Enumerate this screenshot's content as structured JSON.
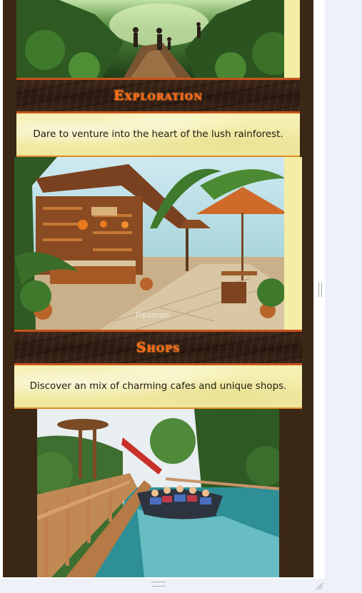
{
  "sections": [
    {
      "title": "Exploration",
      "description": "Dare to venture into the heart of the lush rainforest.",
      "image_alt": "jungle-trail-hikers"
    },
    {
      "title": "Shops",
      "description": "Discover an mix of charming cafes and unique shops.",
      "image_alt": "tropical-market-stall",
      "watermark": "Pikamon"
    },
    {
      "title": "",
      "description": "",
      "image_alt": "water-ride-boat"
    }
  ],
  "colors": {
    "background": "#3a2714",
    "title_orange": "#ff6a12",
    "panel_yellow": "#f3eda6",
    "accent_border": "#c8541a"
  },
  "icons": [
    "resize-handle-icon",
    "scroll-grip-icon",
    "corner-resize-icon"
  ]
}
